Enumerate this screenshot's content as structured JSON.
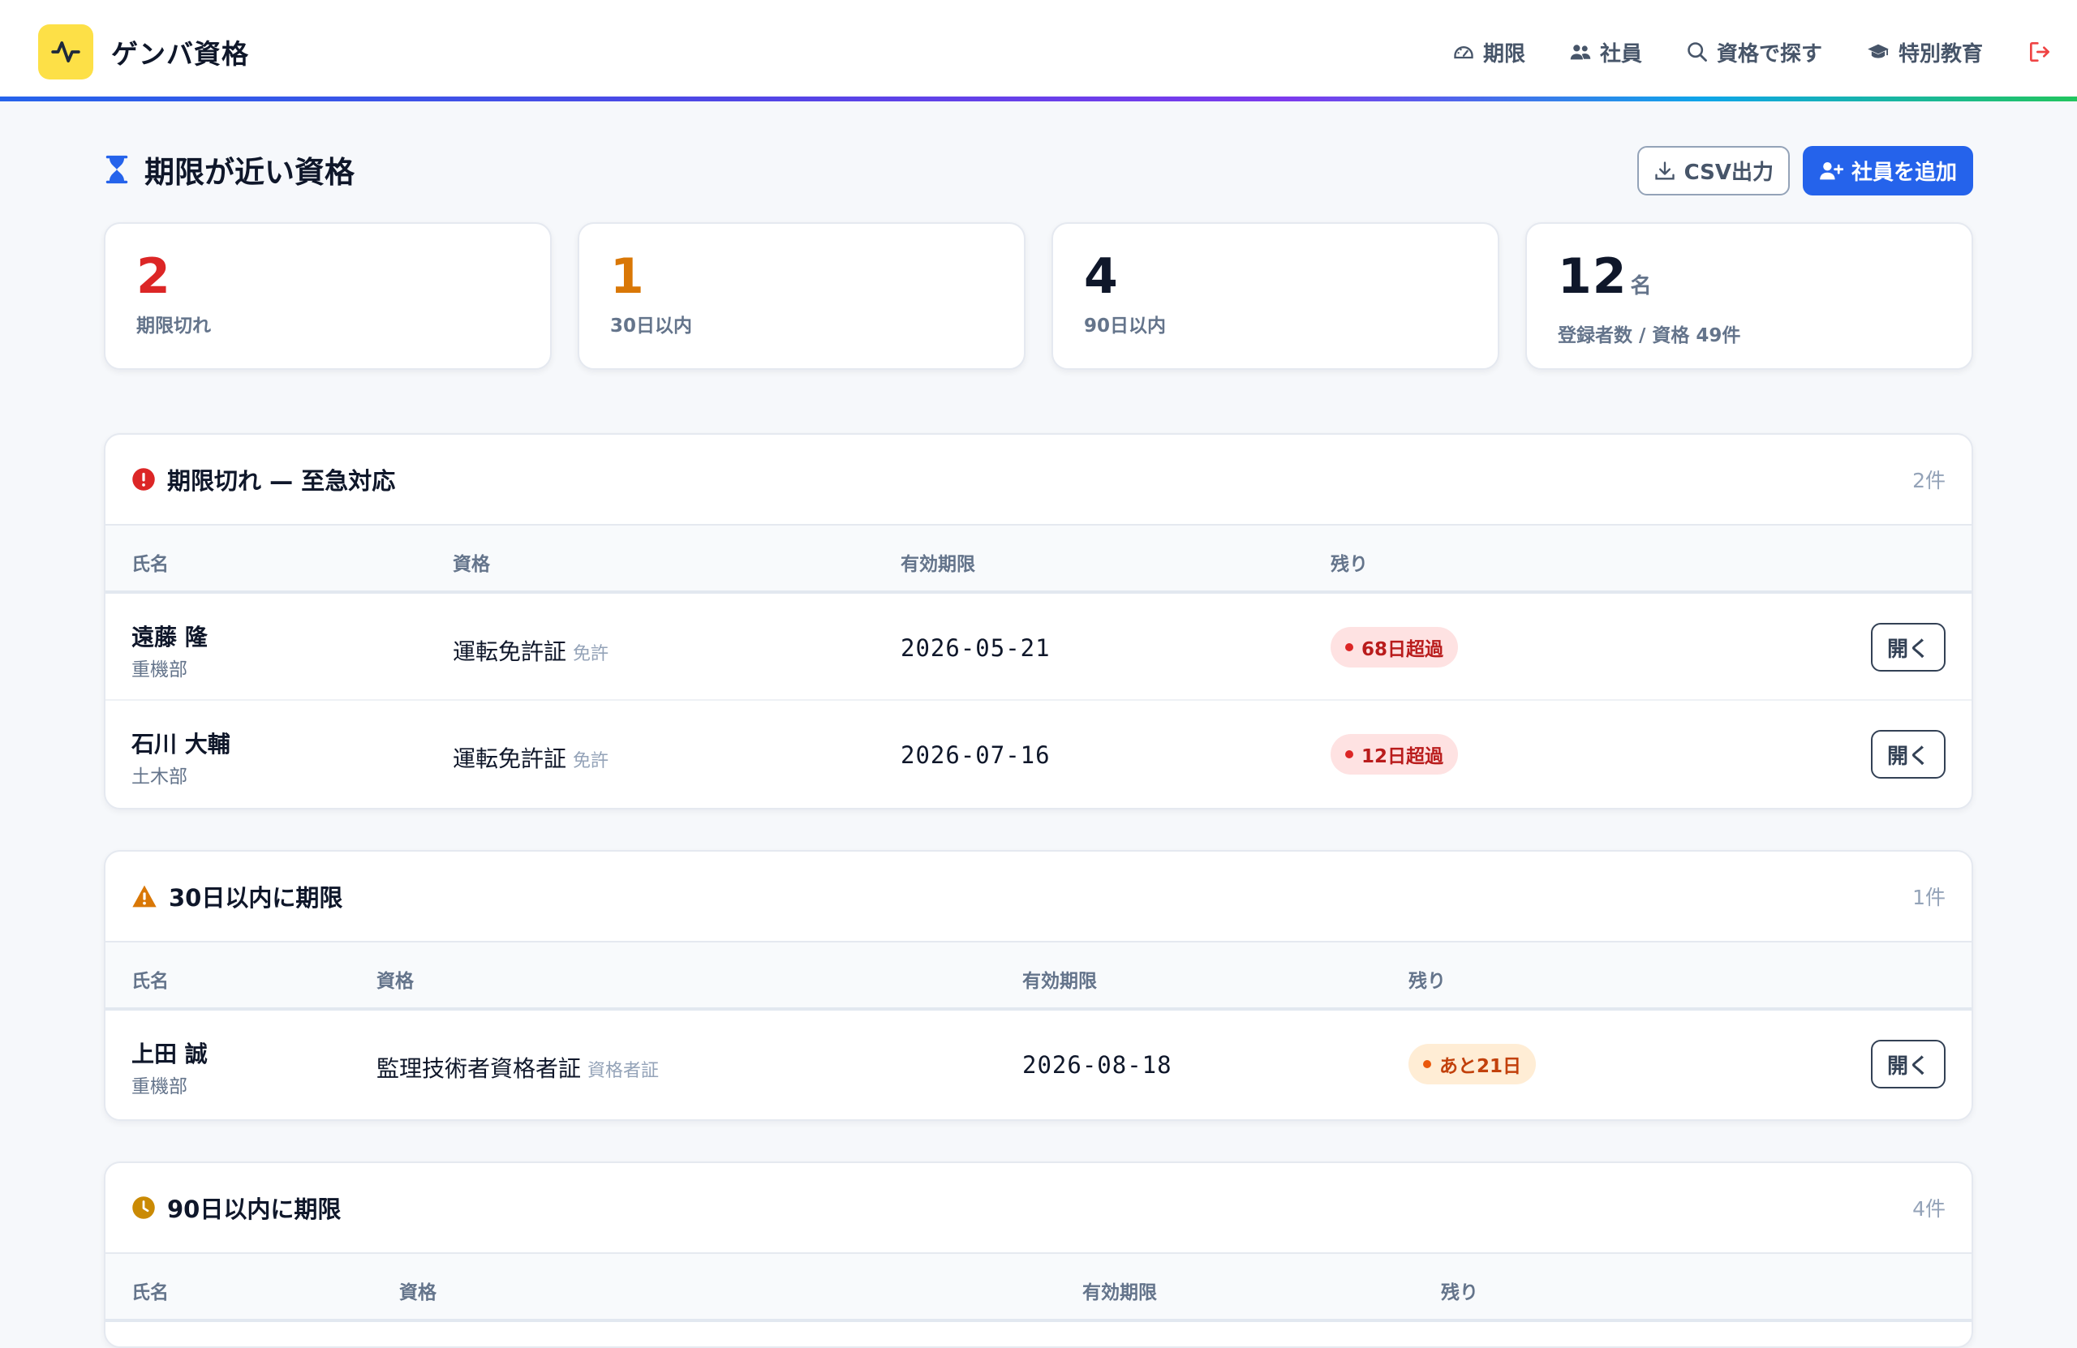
{
  "app": {
    "name": "ゲンバ資格"
  },
  "nav": {
    "items": [
      {
        "label": "期限",
        "icon": "gauge-icon"
      },
      {
        "label": "社員",
        "icon": "users-icon"
      },
      {
        "label": "資格で探す",
        "icon": "search-icon"
      },
      {
        "label": "特別教育",
        "icon": "graduation-cap-icon"
      }
    ],
    "logout_icon": "logout-icon"
  },
  "page": {
    "title": "期限が近い資格",
    "csv_label": "CSV出力",
    "add_label": "社員を追加"
  },
  "stats": [
    {
      "value": "2",
      "label": "期限切れ",
      "color": "#dc2626"
    },
    {
      "value": "1",
      "label": "30日以内",
      "color": "#d97706"
    },
    {
      "value": "4",
      "label": "90日以内",
      "color": "#0f172a"
    },
    {
      "value": "12",
      "unit": "名",
      "label": "登録者数 / 資格 49件",
      "color": "#0f172a"
    }
  ],
  "sections": [
    {
      "title": "期限切れ — 至急対応",
      "count": "2件",
      "icon": "alert-circle-icon",
      "columns": [
        "氏名",
        "資格",
        "有効期限",
        "残り"
      ],
      "rows": [
        {
          "name": "遠藤 隆",
          "dept": "重機部",
          "qualification": "運転免許証",
          "tag": "免許",
          "expiry": "2026-05-21",
          "remaining": "68日超過",
          "open_label": "開く"
        },
        {
          "name": "石川 大輔",
          "dept": "土木部",
          "qualification": "運転免許証",
          "tag": "免許",
          "expiry": "2026-07-16",
          "remaining": "12日超過",
          "open_label": "開く"
        }
      ]
    },
    {
      "title": "30日以内に期限",
      "count": "1件",
      "icon": "warning-triangle-icon",
      "columns": [
        "氏名",
        "資格",
        "有効期限",
        "残り"
      ],
      "rows": [
        {
          "name": "上田 誠",
          "dept": "重機部",
          "qualification": "監理技術者資格者証",
          "tag": "資格者証",
          "expiry": "2026-08-18",
          "remaining": "あと21日",
          "open_label": "開く"
        }
      ]
    },
    {
      "title": "90日以内に期限",
      "count": "4件",
      "icon": "clock-icon",
      "columns": [
        "氏名",
        "資格",
        "有効期限",
        "残り"
      ],
      "rows": []
    }
  ],
  "colors": {
    "accent": "#2563eb",
    "brand_yellow": "#fde047",
    "danger": "#dc2626",
    "warning": "#d97706"
  }
}
